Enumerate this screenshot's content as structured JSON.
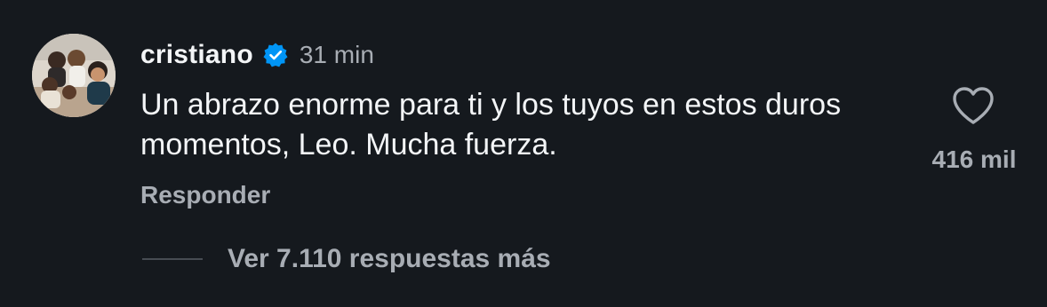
{
  "comment": {
    "username": "cristiano",
    "verified": true,
    "verified_icon": "verified-badge-icon",
    "time_ago": "31 min",
    "text": "Un abrazo enorme para ti y los tuyos en estos duros momentos, Leo. Mucha fuerza.",
    "reply_label": "Responder",
    "like_icon": "heart-outline-icon",
    "like_count": "416 mil",
    "more_replies_label": "Ver 7.110 respuestas más"
  },
  "colors": {
    "background": "#15191e",
    "primary_text": "#f3f5f7",
    "secondary_text": "#a8adb4",
    "verified_blue": "#0095f6"
  }
}
